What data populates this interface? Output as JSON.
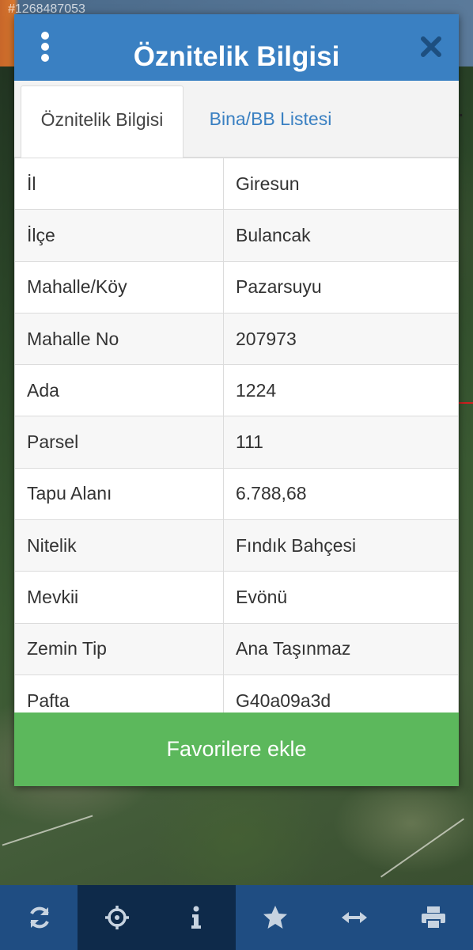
{
  "map": {
    "watermark": "#1268487053"
  },
  "dialog": {
    "title": "Öznitelik Bilgisi",
    "menu_icon": "vertical-dots-icon",
    "close_icon": "close-icon",
    "tabs": [
      {
        "label": "Öznitelik Bilgisi",
        "active": true
      },
      {
        "label": "Bina/BB Listesi",
        "active": false
      }
    ],
    "rows": [
      {
        "key": "İl",
        "value": "Giresun"
      },
      {
        "key": "İlçe",
        "value": "Bulancak"
      },
      {
        "key": "Mahalle/Köy",
        "value": "Pazarsuyu"
      },
      {
        "key": "Mahalle No",
        "value": "207973"
      },
      {
        "key": "Ada",
        "value": "1224"
      },
      {
        "key": "Parsel",
        "value": "111"
      },
      {
        "key": "Tapu Alanı",
        "value": "6.788,68"
      },
      {
        "key": "Nitelik",
        "value": "Fındık Bahçesi"
      },
      {
        "key": "Mevkii",
        "value": "Evönü"
      },
      {
        "key": "Zemin Tip",
        "value": "Ana Taşınmaz"
      },
      {
        "key": "Pafta",
        "value": "G40a09a3d"
      }
    ],
    "favorite_button": "Favorilere ekle"
  },
  "toolbar": {
    "items": [
      {
        "icon": "refresh-icon",
        "active": false
      },
      {
        "icon": "locate-icon",
        "active": true
      },
      {
        "icon": "info-icon",
        "active": true
      },
      {
        "icon": "star-icon",
        "active": false
      },
      {
        "icon": "measure-arrows-icon",
        "active": false
      },
      {
        "icon": "print-icon",
        "active": false
      }
    ]
  },
  "colors": {
    "header_blue": "#3a80c2",
    "button_green": "#5cb85c",
    "toolbar_blue": "#1f4d82",
    "toolbar_active": "#0e2a4a"
  }
}
